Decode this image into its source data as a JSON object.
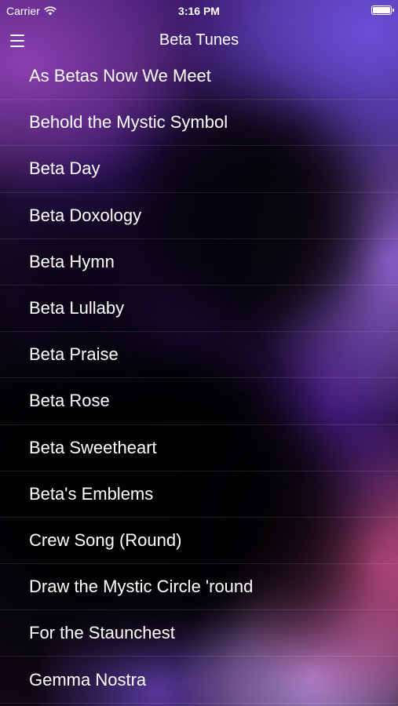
{
  "status_bar": {
    "carrier": "Carrier",
    "time": "3:16 PM",
    "wifi_icon": "wifi-icon",
    "battery_icon": "battery-icon",
    "battery_level": 1.0
  },
  "nav": {
    "title": "Beta Tunes",
    "menu_icon": "hamburger-menu-icon"
  },
  "songs": [
    "As Betas Now We Meet",
    "Behold the Mystic Symbol",
    "Beta Day",
    "Beta Doxology",
    "Beta Hymn",
    "Beta Lullaby",
    "Beta Praise",
    "Beta Rose",
    "Beta Sweetheart",
    "Beta's Emblems",
    "Crew Song (Round)",
    "Draw the Mystic Circle 'round",
    "For the Staunchest",
    "Gemma Nostra"
  ],
  "colors": {
    "text": "#ffffff",
    "accent_purple": "#6a4fd8",
    "accent_pink": "#c24e86",
    "separator": "rgba(255,255,255,0.1)"
  }
}
